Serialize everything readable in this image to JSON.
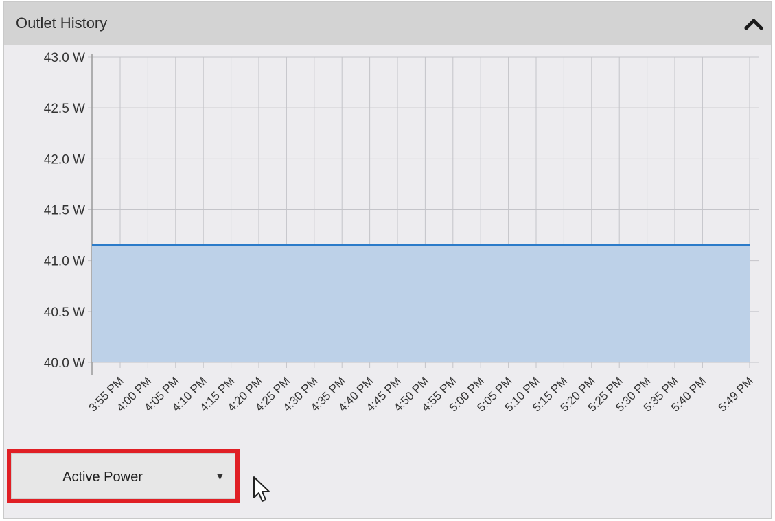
{
  "panel": {
    "title": "Outlet History",
    "collapse_icon": "chevron-up-icon"
  },
  "metric_select": {
    "selected": "Active Power",
    "arrow_icon": "dropdown-triangle-icon"
  },
  "colors": {
    "line": "#2b7bc9",
    "fill": "#bdd1e8",
    "grid": "#c4c4c9",
    "highlight": "#e01f25"
  },
  "chart_data": {
    "type": "area",
    "x": [
      "3:55 PM",
      "4:00 PM",
      "4:05 PM",
      "4:10 PM",
      "4:15 PM",
      "4:20 PM",
      "4:25 PM",
      "4:30 PM",
      "4:35 PM",
      "4:40 PM",
      "4:45 PM",
      "4:50 PM",
      "4:55 PM",
      "5:00 PM",
      "5:05 PM",
      "5:10 PM",
      "5:15 PM",
      "5:20 PM",
      "5:25 PM",
      "5:30 PM",
      "5:35 PM",
      "5:40 PM",
      "5:49 PM"
    ],
    "series": [
      {
        "values": [
          41.15,
          41.15,
          41.15,
          41.15,
          41.15,
          41.15,
          41.15,
          41.15,
          41.15,
          41.15,
          41.15,
          41.15,
          41.15,
          41.15,
          41.15,
          41.15,
          41.15,
          41.15,
          41.15,
          41.15,
          41.15,
          41.15,
          41.15
        ]
      }
    ],
    "yticks": [
      "43.0 W",
      "42.5 W",
      "42.0 W",
      "41.5 W",
      "41.0 W",
      "40.5 W",
      "40.0 W"
    ],
    "ylim": [
      40.0,
      43.0
    ],
    "grid": true
  }
}
